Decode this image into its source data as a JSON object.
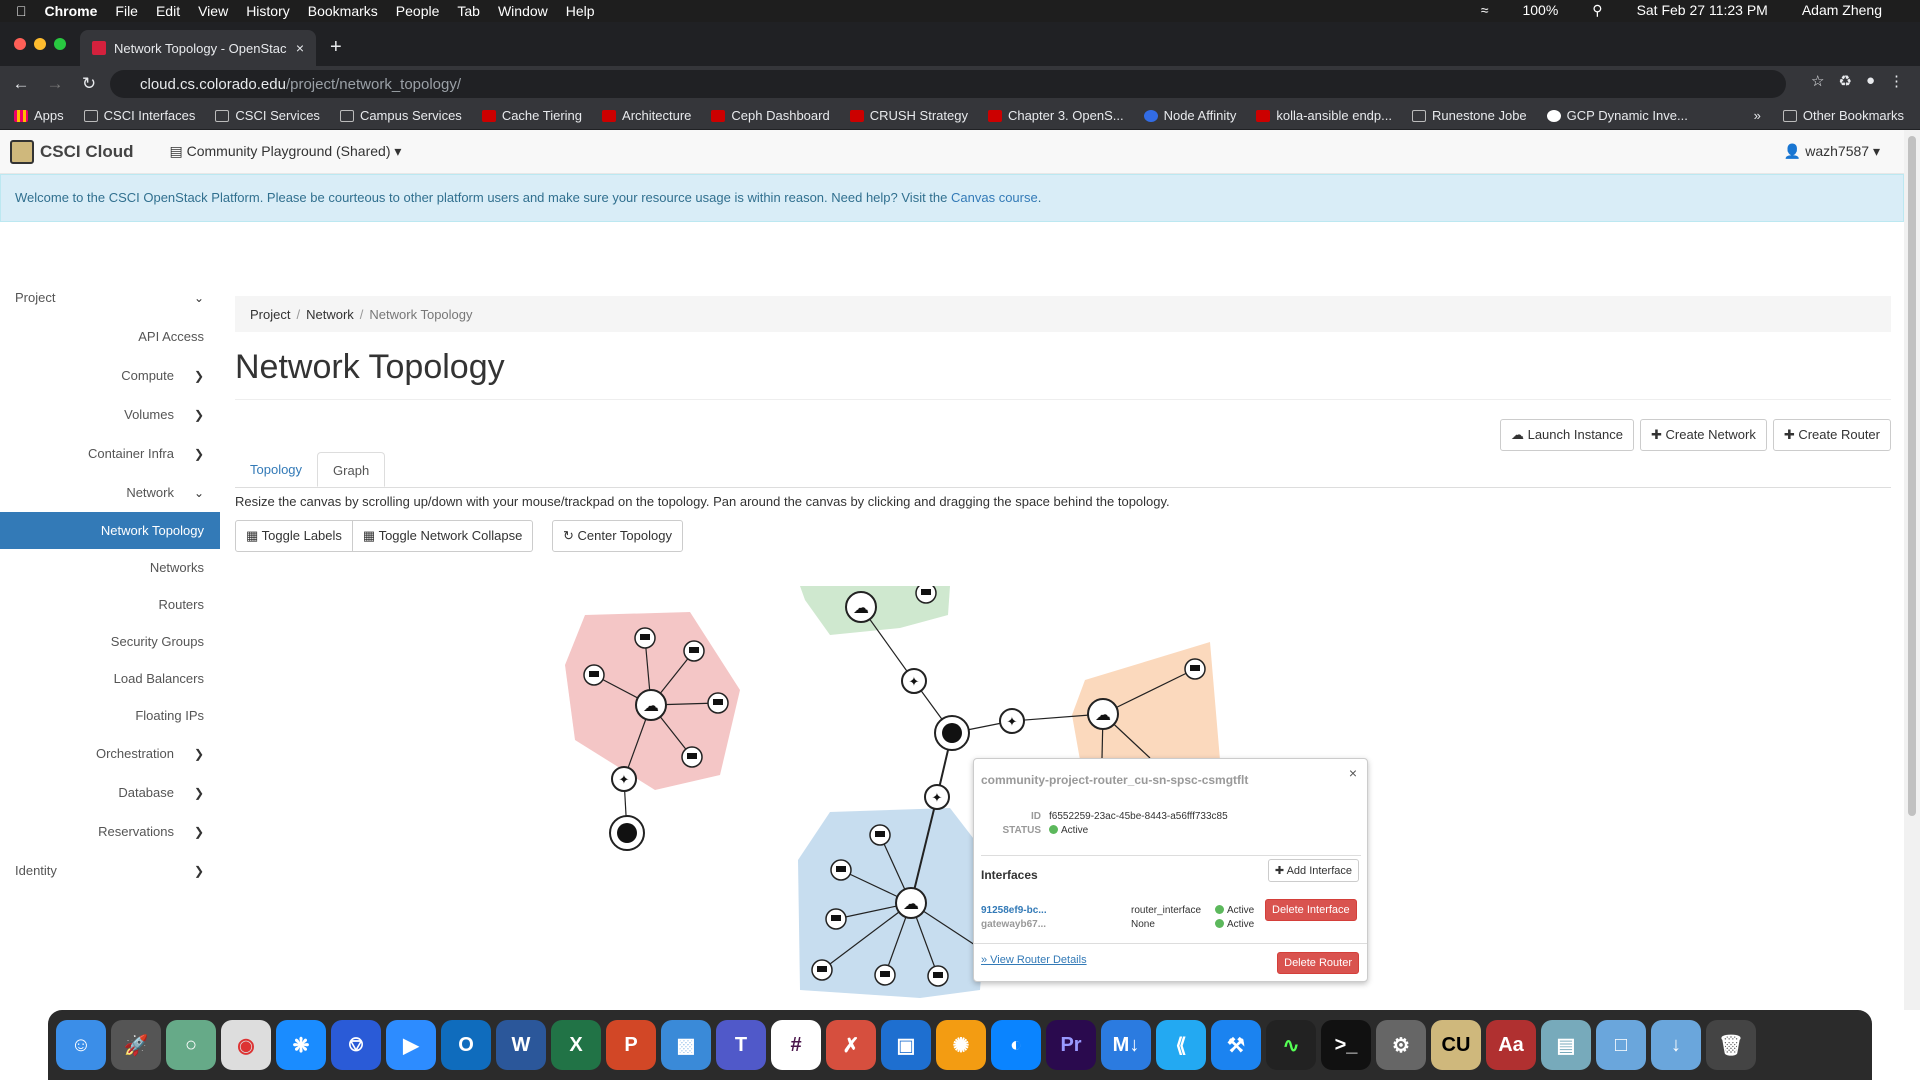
{
  "menubar": {
    "apple": "",
    "app": "Chrome",
    "items": [
      "File",
      "Edit",
      "View",
      "History",
      "Bookmarks",
      "People",
      "Tab",
      "Window",
      "Help"
    ],
    "battery": "100%",
    "datetime": "Sat Feb 27  11:23 PM",
    "user": "Adam Zheng"
  },
  "browser": {
    "tab_title": "Network Topology - OpenStac",
    "url_host": "cloud.cs.colorado.edu",
    "url_path": "/project/network_topology/",
    "bookmarks": [
      "Apps",
      "CSCI Interfaces",
      "CSCI Services",
      "Campus Services",
      "Cache Tiering",
      "Architecture",
      "Ceph Dashboard",
      "CRUSH Strategy",
      "Chapter 3. OpenS...",
      "Node Affinity",
      "kolla-ansible endp...",
      "Runestone Jobe",
      "GCP Dynamic Inve..."
    ],
    "bookmarks_more": "»",
    "other_bookmarks": "Other Bookmarks"
  },
  "header": {
    "brand": "CSCI Cloud",
    "project": "Community Playground (Shared)",
    "user": "wazh7587"
  },
  "alert": {
    "text": "Welcome to the CSCI OpenStack Platform. Please be courteous to other platform users and make sure your resource usage is within reason. Need help? Visit the ",
    "link": "Canvas course",
    "tail": "."
  },
  "sidebar": {
    "project": "Project",
    "api": "API Access",
    "compute": "Compute",
    "volumes": "Volumes",
    "container": "Container Infra",
    "network": "Network",
    "network_items": [
      "Network Topology",
      "Networks",
      "Routers",
      "Security Groups",
      "Load Balancers",
      "Floating IPs"
    ],
    "orchestration": "Orchestration",
    "database": "Database",
    "reservations": "Reservations",
    "identity": "Identity"
  },
  "breadcrumb": [
    "Project",
    "Network",
    "Network Topology"
  ],
  "page_title": "Network Topology",
  "actions": {
    "launch": "Launch Instance",
    "create_network": "Create Network",
    "create_router": "Create Router"
  },
  "tabs": [
    "Topology",
    "Graph"
  ],
  "hint": "Resize the canvas by scrolling up/down with your mouse/trackpad on the topology. Pan around the canvas by clicking and dragging the space behind the topology.",
  "topo_buttons": {
    "labels": "Toggle Labels",
    "collapse": "Toggle Network Collapse",
    "center": "Center Topology"
  },
  "popup": {
    "router_name": "community-project-router_cu-sn-spsc-csmgtflt",
    "id_label": "ID",
    "id": "f6552259-23ac-45be-8443-a56fff733c85",
    "status_label": "STATUS",
    "status": "Active",
    "interfaces_title": "Interfaces",
    "add_interface": "Add Interface",
    "interfaces": [
      {
        "id": "91258ef9-bc...",
        "type": "router_interface",
        "status": "Active",
        "delete": "Delete Interface"
      },
      {
        "id": "gatewayb67...",
        "type": "None",
        "status": "Active"
      }
    ],
    "view_details": "» View Router Details",
    "delete_router": "Delete Router",
    "close": "×"
  },
  "colors": {
    "pink": "#f4c6c6",
    "green": "#cfe8cf",
    "orange": "#fbd9bd",
    "blue": "#c7ddef",
    "accent": "#337ab7",
    "danger": "#d9534f"
  }
}
